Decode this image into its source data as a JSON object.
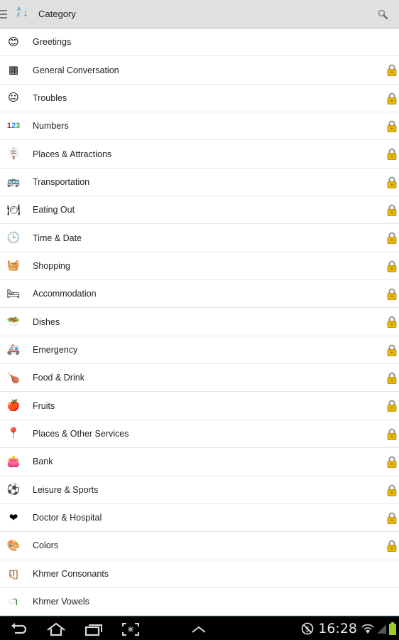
{
  "actionbar": {
    "title": "Category",
    "menu_icon": "hamburger-icon",
    "sort_icon": "sort-az-icon",
    "search_icon": "search-icon"
  },
  "categories": [
    {
      "label": "Greetings",
      "icon": "smiley-speech-icon",
      "glyph": "😊",
      "locked": false
    },
    {
      "label": "General Conversation",
      "icon": "colored-blocks-icon",
      "glyph": "▦",
      "locked": true
    },
    {
      "label": "Troubles",
      "icon": "yellow-smiley-icon",
      "glyph": "😐",
      "locked": true
    },
    {
      "label": "Numbers",
      "icon": "numbers-123-icon",
      "glyph": "123",
      "locked": true
    },
    {
      "label": "Places & Attractions",
      "icon": "signpost-icon",
      "glyph": "🪧",
      "locked": true
    },
    {
      "label": "Transportation",
      "icon": "bus-icon",
      "glyph": "🚌",
      "locked": true
    },
    {
      "label": "Eating Out",
      "icon": "plate-icon",
      "glyph": "🍽",
      "locked": true
    },
    {
      "label": "Time & Date",
      "icon": "clock-icon",
      "glyph": "🕒",
      "locked": true
    },
    {
      "label": "Shopping",
      "icon": "basket-icon",
      "glyph": "🧺",
      "locked": true
    },
    {
      "label": "Accommodation",
      "icon": "bed-icon",
      "glyph": "🛏",
      "locked": true
    },
    {
      "label": "Dishes",
      "icon": "bowl-icon",
      "glyph": "🥗",
      "locked": true
    },
    {
      "label": "Emergency",
      "icon": "ambulance-icon",
      "glyph": "🚑",
      "locked": true
    },
    {
      "label": "Food & Drink",
      "icon": "roast-chicken-icon",
      "glyph": "🍗",
      "locked": true
    },
    {
      "label": "Fruits",
      "icon": "fruit-basket-icon",
      "glyph": "🍎",
      "locked": true
    },
    {
      "label": "Places & Other Services",
      "icon": "map-pin-icon",
      "glyph": "📍",
      "locked": true
    },
    {
      "label": "Bank",
      "icon": "wallet-icon",
      "glyph": "👛",
      "locked": true
    },
    {
      "label": "Leisure & Sports",
      "icon": "soccer-ball-icon",
      "glyph": "⚽",
      "locked": true
    },
    {
      "label": "Doctor & Hospital",
      "icon": "medical-heart-icon",
      "glyph": "❤",
      "locked": true
    },
    {
      "label": "Colors",
      "icon": "color-swatch-icon",
      "glyph": "🎨",
      "locked": true
    },
    {
      "label": "Khmer Consonants",
      "icon": "khmer-consonant-icon",
      "glyph": "ញ",
      "locked": false
    },
    {
      "label": "Khmer Vowels",
      "icon": "khmer-vowel-icon",
      "glyph": "ា",
      "locked": false
    }
  ],
  "statusbar": {
    "time": "16:28"
  },
  "colors": {
    "accent": "#2b9bd6",
    "actionbar_bg": "#e0e0e0",
    "lock": "#e6b800",
    "battery": "#9ccc2a"
  }
}
